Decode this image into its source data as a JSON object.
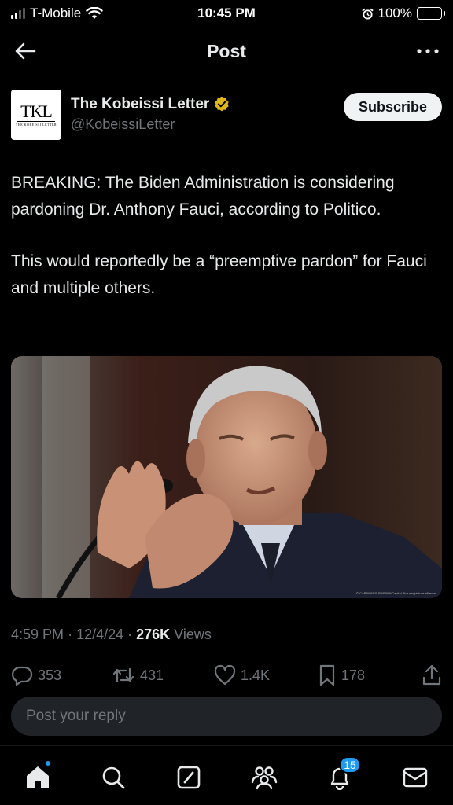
{
  "status_bar": {
    "carrier": "T-Mobile",
    "time": "10:45 PM",
    "battery": "100%"
  },
  "header": {
    "title": "Post"
  },
  "author": {
    "avatar_text": "TKL",
    "avatar_subtext": "THE KOBEISSI LETTER",
    "name": "The Kobeissi Letter",
    "handle": "@KobeissiLetter",
    "subscribe_label": "Subscribe"
  },
  "post": {
    "paragraphs": [
      "BREAKING: The Biden Administration is considering pardoning Dr. Anthony Fauci, according to Politico.",
      "This would reportedly be a “preemptive pardon” for Fauci and multiple others."
    ],
    "photo_credit": "© CAP/NPI/ES SMS/NPI/Capital Pictures/picture alliance"
  },
  "meta": {
    "time": "4:59 PM",
    "date": "12/4/24",
    "views_count": "276K",
    "views_label": "Views"
  },
  "actions": {
    "replies": "353",
    "reposts": "431",
    "likes": "1.4K",
    "bookmarks": "178"
  },
  "reply_box": {
    "placeholder": "Post your reply"
  },
  "bottom_nav": {
    "notifications_badge": "15"
  },
  "colors": {
    "background": "#000000",
    "text_primary": "#e7e9ea",
    "text_secondary": "#71767b",
    "accent": "#1d9bf0",
    "verified_gold": "#e2b719"
  }
}
